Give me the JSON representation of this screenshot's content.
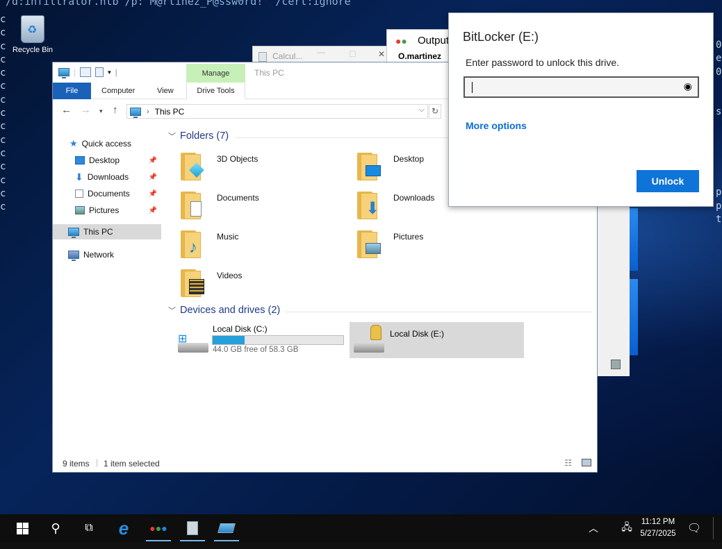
{
  "terminal": {
    "top_line": "/d:infiltrator.htb /p:'M@rtinez_P@ssw0rd!' /cert:ignore",
    "left_col": "c\nc\nc\nc\nc\nc\nc\nc\nc\nc\nc\nc\nc\nc\nc",
    "right_col": "0\ne\n0\n\n\ns\n\n\n\n\n\np\np\nt"
  },
  "desktop": {
    "recycle_bin_label": "Recycle Bin"
  },
  "background_windows": {
    "calculator_title": "Calcul...",
    "output_title": "Output",
    "output_user": "O.martinez"
  },
  "explorer": {
    "title": "This PC",
    "manage_tab": "Manage",
    "ribbon_tabs": {
      "file": "File",
      "computer": "Computer",
      "view": "View",
      "drive_tools": "Drive Tools"
    },
    "address": "This PC",
    "nav": {
      "quick_access": "Quick access",
      "desktop": "Desktop",
      "downloads": "Downloads",
      "documents": "Documents",
      "pictures": "Pictures",
      "this_pc": "This PC",
      "network": "Network"
    },
    "folders_header": "Folders (7)",
    "folders": {
      "objects3d": "3D Objects",
      "desktop": "Desktop",
      "documents": "Documents",
      "downloads": "Downloads",
      "music": "Music",
      "pictures": "Pictures",
      "videos": "Videos"
    },
    "devices_header": "Devices and drives (2)",
    "drive_c": {
      "name": "Local Disk (C:)",
      "free_text": "44.0 GB free of 58.3 GB",
      "used_fraction": 0.245
    },
    "drive_e": {
      "name": "Local Disk (E:)"
    },
    "status": {
      "items": "9 items",
      "selected": "1 item selected"
    }
  },
  "bitlocker": {
    "title": "BitLocker (E:)",
    "prompt": "Enter password to unlock this drive.",
    "password_value": "",
    "more_options": "More options",
    "unlock_button": "Unlock"
  },
  "taskbar": {
    "time": "11:12 PM",
    "date": "5/27/2025",
    "icons": [
      "start-icon",
      "search-icon",
      "task-view-icon",
      "ie-icon",
      "connect-icon",
      "calculator-icon",
      "rdp-icon"
    ]
  },
  "colors": {
    "accent": "#0e74d8",
    "link": "#0a6cd6",
    "explorer_file_tab": "#1a62b8",
    "manage_tab": "#c7f0b8",
    "drive_bar": "#26a0da"
  }
}
